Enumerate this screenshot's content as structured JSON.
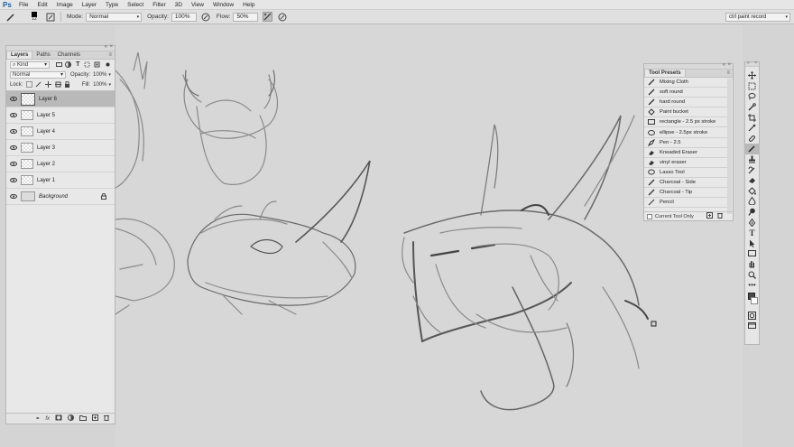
{
  "app": {
    "logo": "Ps"
  },
  "menu": [
    "File",
    "Edit",
    "Image",
    "Layer",
    "Type",
    "Select",
    "Filter",
    "3D",
    "View",
    "Window",
    "Help"
  ],
  "options_bar": {
    "brush_size": "12",
    "mode_label": "Mode:",
    "mode_value": "Normal",
    "opacity_label": "Opacity:",
    "opacity_value": "100%",
    "flow_label": "Flow:",
    "flow_value": "50%",
    "workspace": "ctrl paint record"
  },
  "layers_panel": {
    "tabs": [
      "Layers",
      "Paths",
      "Channels"
    ],
    "filter_label": "Kind",
    "blend_mode": "Normal",
    "opacity_label": "Opacity:",
    "opacity_value": "100%",
    "lock_label": "Lock:",
    "fill_label": "Fill:",
    "fill_value": "100%",
    "layers": [
      {
        "name": "Layer 6",
        "selected": true
      },
      {
        "name": "Layer 5",
        "selected": false
      },
      {
        "name": "Layer 4",
        "selected": false
      },
      {
        "name": "Layer 3",
        "selected": false
      },
      {
        "name": "Layer 2",
        "selected": false
      },
      {
        "name": "Layer 1",
        "selected": false
      },
      {
        "name": "Background",
        "selected": false,
        "locked": true
      }
    ],
    "footer_fx": "fx"
  },
  "tool_presets": {
    "title": "Tool Presets",
    "items": [
      {
        "label": "Mixing Cloth",
        "icon": "brush-icon"
      },
      {
        "label": "soft round",
        "icon": "brush-icon"
      },
      {
        "label": "hard round",
        "icon": "brush-icon"
      },
      {
        "label": "Paint bucket",
        "icon": "bucket-icon"
      },
      {
        "label": "rectangle - 2.5 px stroke",
        "icon": "rectangle-icon"
      },
      {
        "label": "ellipse - 2.5px stroke",
        "icon": "ellipse-icon"
      },
      {
        "label": "Pen - 2.5",
        "icon": "pen-icon"
      },
      {
        "label": "Kneaded Eraser",
        "icon": "eraser-icon"
      },
      {
        "label": "vinyl eraser",
        "icon": "eraser-icon"
      },
      {
        "label": "Lasso Tool",
        "icon": "lasso-icon"
      },
      {
        "label": "Charcoal - Side",
        "icon": "brush-icon"
      },
      {
        "label": "Charcoal - Tip",
        "icon": "brush-icon"
      },
      {
        "label": "Pencil",
        "icon": "pencil-icon"
      }
    ],
    "current_tool_only": "Current Tool Only"
  },
  "toolbar": {
    "tools": [
      "move-tool",
      "marquee-tool",
      "lasso-tool",
      "quick-select-tool",
      "crop-tool",
      "eyedropper-tool",
      "healing-tool",
      "brush-tool",
      "stamp-tool",
      "history-brush-tool",
      "eraser-tool",
      "bucket-tool",
      "blur-tool",
      "dodge-tool",
      "pen-tool",
      "type-tool",
      "path-select-tool",
      "shape-tool",
      "hand-tool",
      "zoom-tool",
      "more-tools",
      "color-swatches",
      "quick-mask",
      "screen-mode"
    ],
    "selected": "brush-tool"
  }
}
